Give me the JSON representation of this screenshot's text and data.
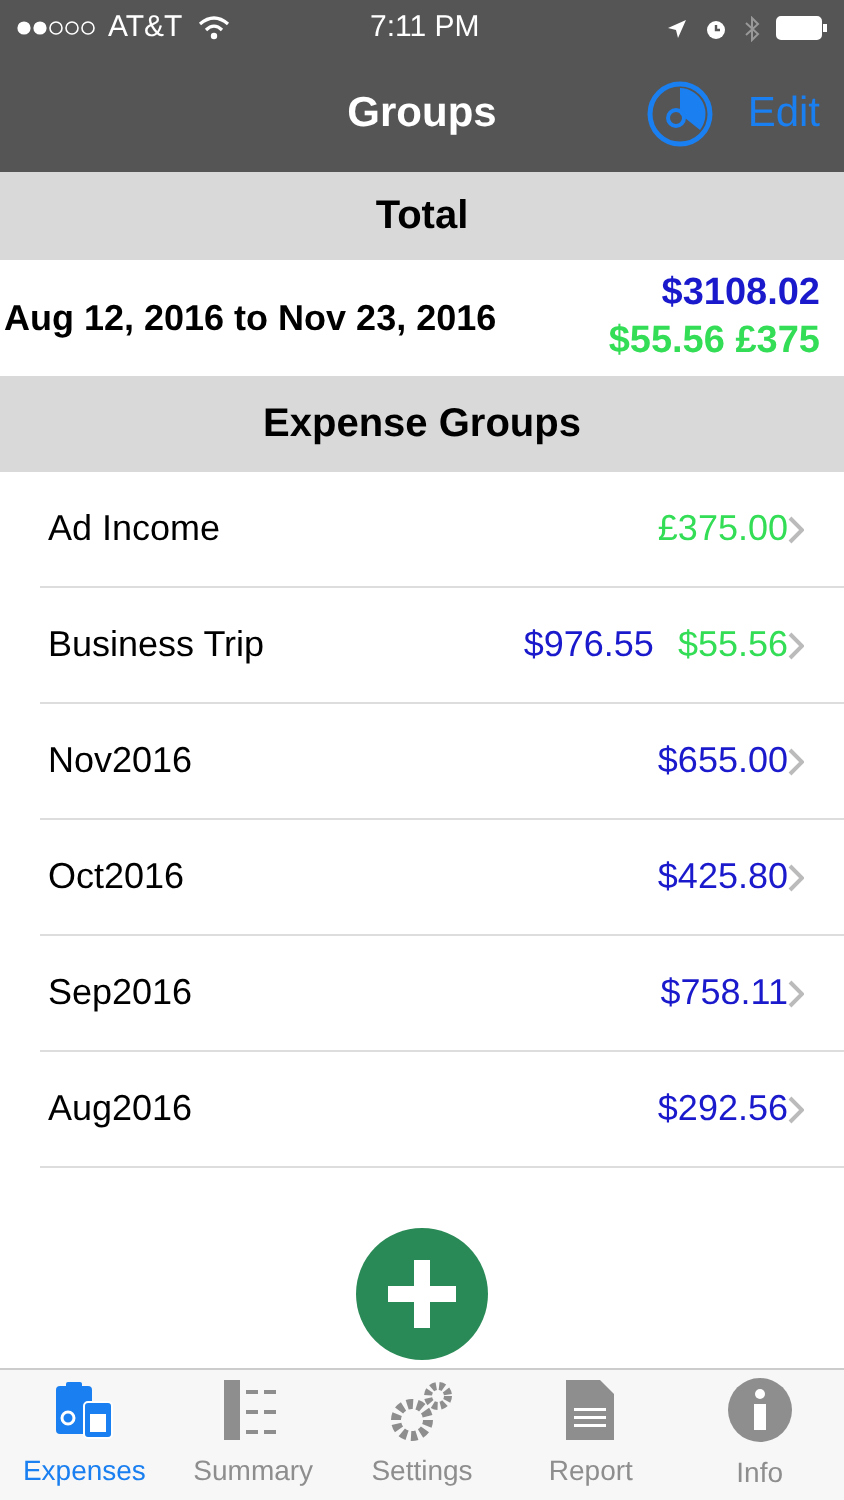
{
  "status_bar": {
    "carrier": "AT&T",
    "time": "7:11 PM"
  },
  "nav": {
    "title": "Groups",
    "edit": "Edit"
  },
  "total": {
    "header": "Total",
    "range": "Aug 12, 2016 to Nov 23, 2016",
    "amounts": [
      {
        "text": "$3108.02",
        "kind": "expense"
      },
      {
        "text": "$55.56 £375",
        "kind": "income"
      }
    ]
  },
  "groups": {
    "header": "Expense Groups",
    "rows": [
      {
        "name": "Ad Income",
        "amounts": [
          {
            "text": "£375.00",
            "kind": "income"
          }
        ]
      },
      {
        "name": "Business Trip",
        "amounts": [
          {
            "text": "$976.55",
            "kind": "expense"
          },
          {
            "text": "$55.56",
            "kind": "income"
          }
        ]
      },
      {
        "name": "Nov2016",
        "amounts": [
          {
            "text": "$655.00",
            "kind": "expense"
          }
        ]
      },
      {
        "name": "Oct2016",
        "amounts": [
          {
            "text": "$425.80",
            "kind": "expense"
          }
        ]
      },
      {
        "name": "Sep2016",
        "amounts": [
          {
            "text": "$758.11",
            "kind": "expense"
          }
        ]
      },
      {
        "name": "Aug2016",
        "amounts": [
          {
            "text": "$292.56",
            "kind": "expense"
          }
        ]
      }
    ]
  },
  "tabs": [
    {
      "label": "Expenses",
      "selected": true
    },
    {
      "label": "Summary",
      "selected": false
    },
    {
      "label": "Settings",
      "selected": false
    },
    {
      "label": "Report",
      "selected": false
    },
    {
      "label": "Info",
      "selected": false
    }
  ]
}
